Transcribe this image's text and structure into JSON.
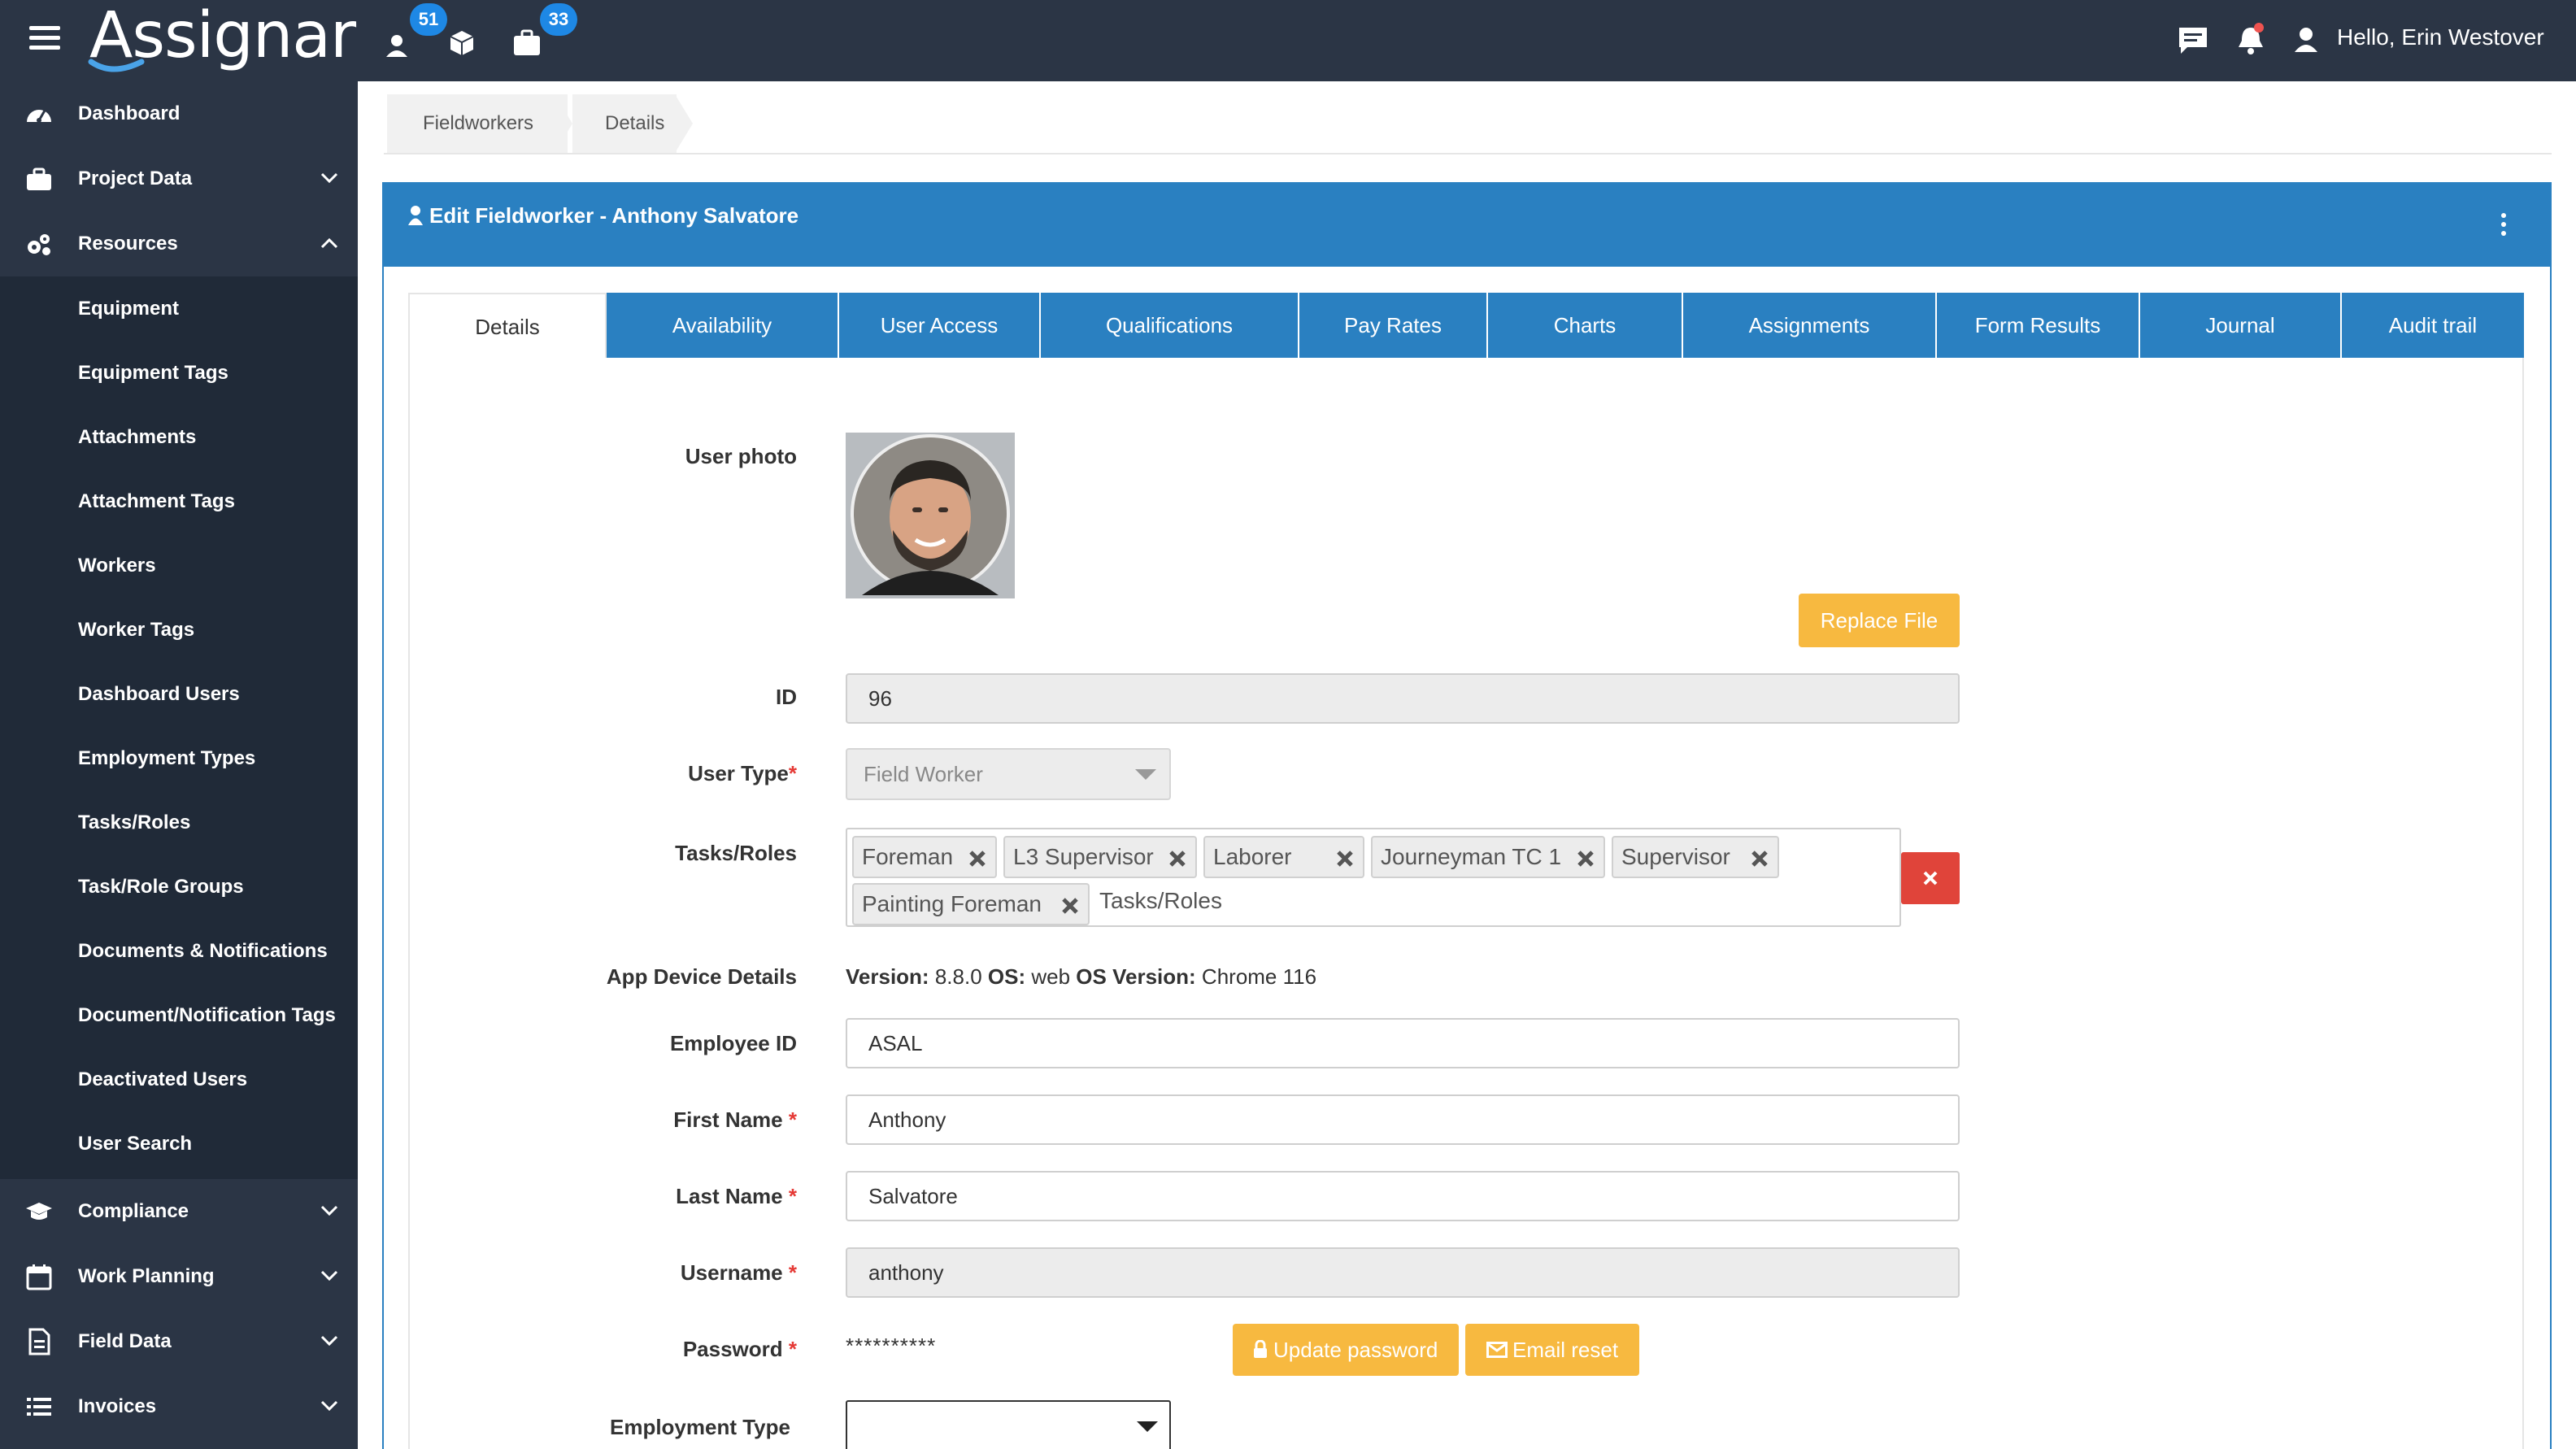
{
  "app": {
    "logo_text": "Assignar",
    "badges": {
      "people": "51",
      "briefcase": "33"
    },
    "greeting": "Hello, Erin Westover",
    "icons": [
      "menu-icon",
      "person-icon",
      "cube-icon",
      "briefcase-icon",
      "chat-icon",
      "bell-icon",
      "user-icon"
    ]
  },
  "sidebar": {
    "items": [
      {
        "label": "Dashboard",
        "icon": "speedometer-icon"
      },
      {
        "label": "Project Data",
        "icon": "briefcase-icon"
      },
      {
        "label": "Resources",
        "icon": "cogs-icon"
      },
      {
        "label": "Compliance",
        "icon": "graduation-cap-icon"
      },
      {
        "label": "Work Planning",
        "icon": "calendar-icon"
      },
      {
        "label": "Field Data",
        "icon": "document-icon"
      },
      {
        "label": "Invoices",
        "icon": "list-icon"
      }
    ],
    "sub_items": [
      "Equipment",
      "Equipment Tags",
      "Attachments",
      "Attachment Tags",
      "Workers",
      "Worker Tags",
      "Dashboard Users",
      "Employment Types",
      "Tasks/Roles",
      "Task/Role Groups",
      "Documents & Notifications",
      "Document/Notification Tags",
      "Deactivated Users",
      "User Search"
    ]
  },
  "breadcrumb": [
    "Fieldworkers",
    "Details"
  ],
  "panel": {
    "title": "Edit Fieldworker - Anthony Salvatore"
  },
  "tabs": [
    "Details",
    "Availability",
    "User Access",
    "Qualifications",
    "Pay Rates",
    "Charts",
    "Assignments",
    "Form Results",
    "Journal",
    "Audit trail"
  ],
  "form": {
    "photo_label": "User photo",
    "replace_file": "Replace File",
    "id_label": "ID",
    "id_value": "96",
    "user_type_label": "User Type",
    "user_type_value": "Field Worker",
    "tasks_label": "Tasks/Roles",
    "tasks": [
      "Foreman",
      "L3 Supervisor",
      "Laborer",
      "Journeyman TC 1",
      "Supervisor",
      "Painting Foreman"
    ],
    "tasks_placeholder": "Tasks/Roles",
    "device_label": "App Device Details",
    "device": {
      "version_key": "Version:",
      "version": "8.8.0",
      "os_key": "OS:",
      "os": "web",
      "osver_key": "OS Version:",
      "osver": "Chrome 116"
    },
    "employee_id_label": "Employee ID",
    "employee_id": "ASAL",
    "first_name_label": "First Name",
    "first_name": "Anthony",
    "last_name_label": "Last Name",
    "last_name": "Salvatore",
    "username_label": "Username",
    "username": "anthony",
    "password_label": "Password",
    "password_mask": "**********",
    "update_password": "Update password",
    "email_reset": "Email reset",
    "employment_type_label": "Employment Type",
    "required_mark": "*"
  },
  "colors": {
    "nav": "#2b3545",
    "accent": "#2a80c1",
    "warning": "#f7b940",
    "danger": "#e0443a",
    "badge": "#1e88e5"
  }
}
